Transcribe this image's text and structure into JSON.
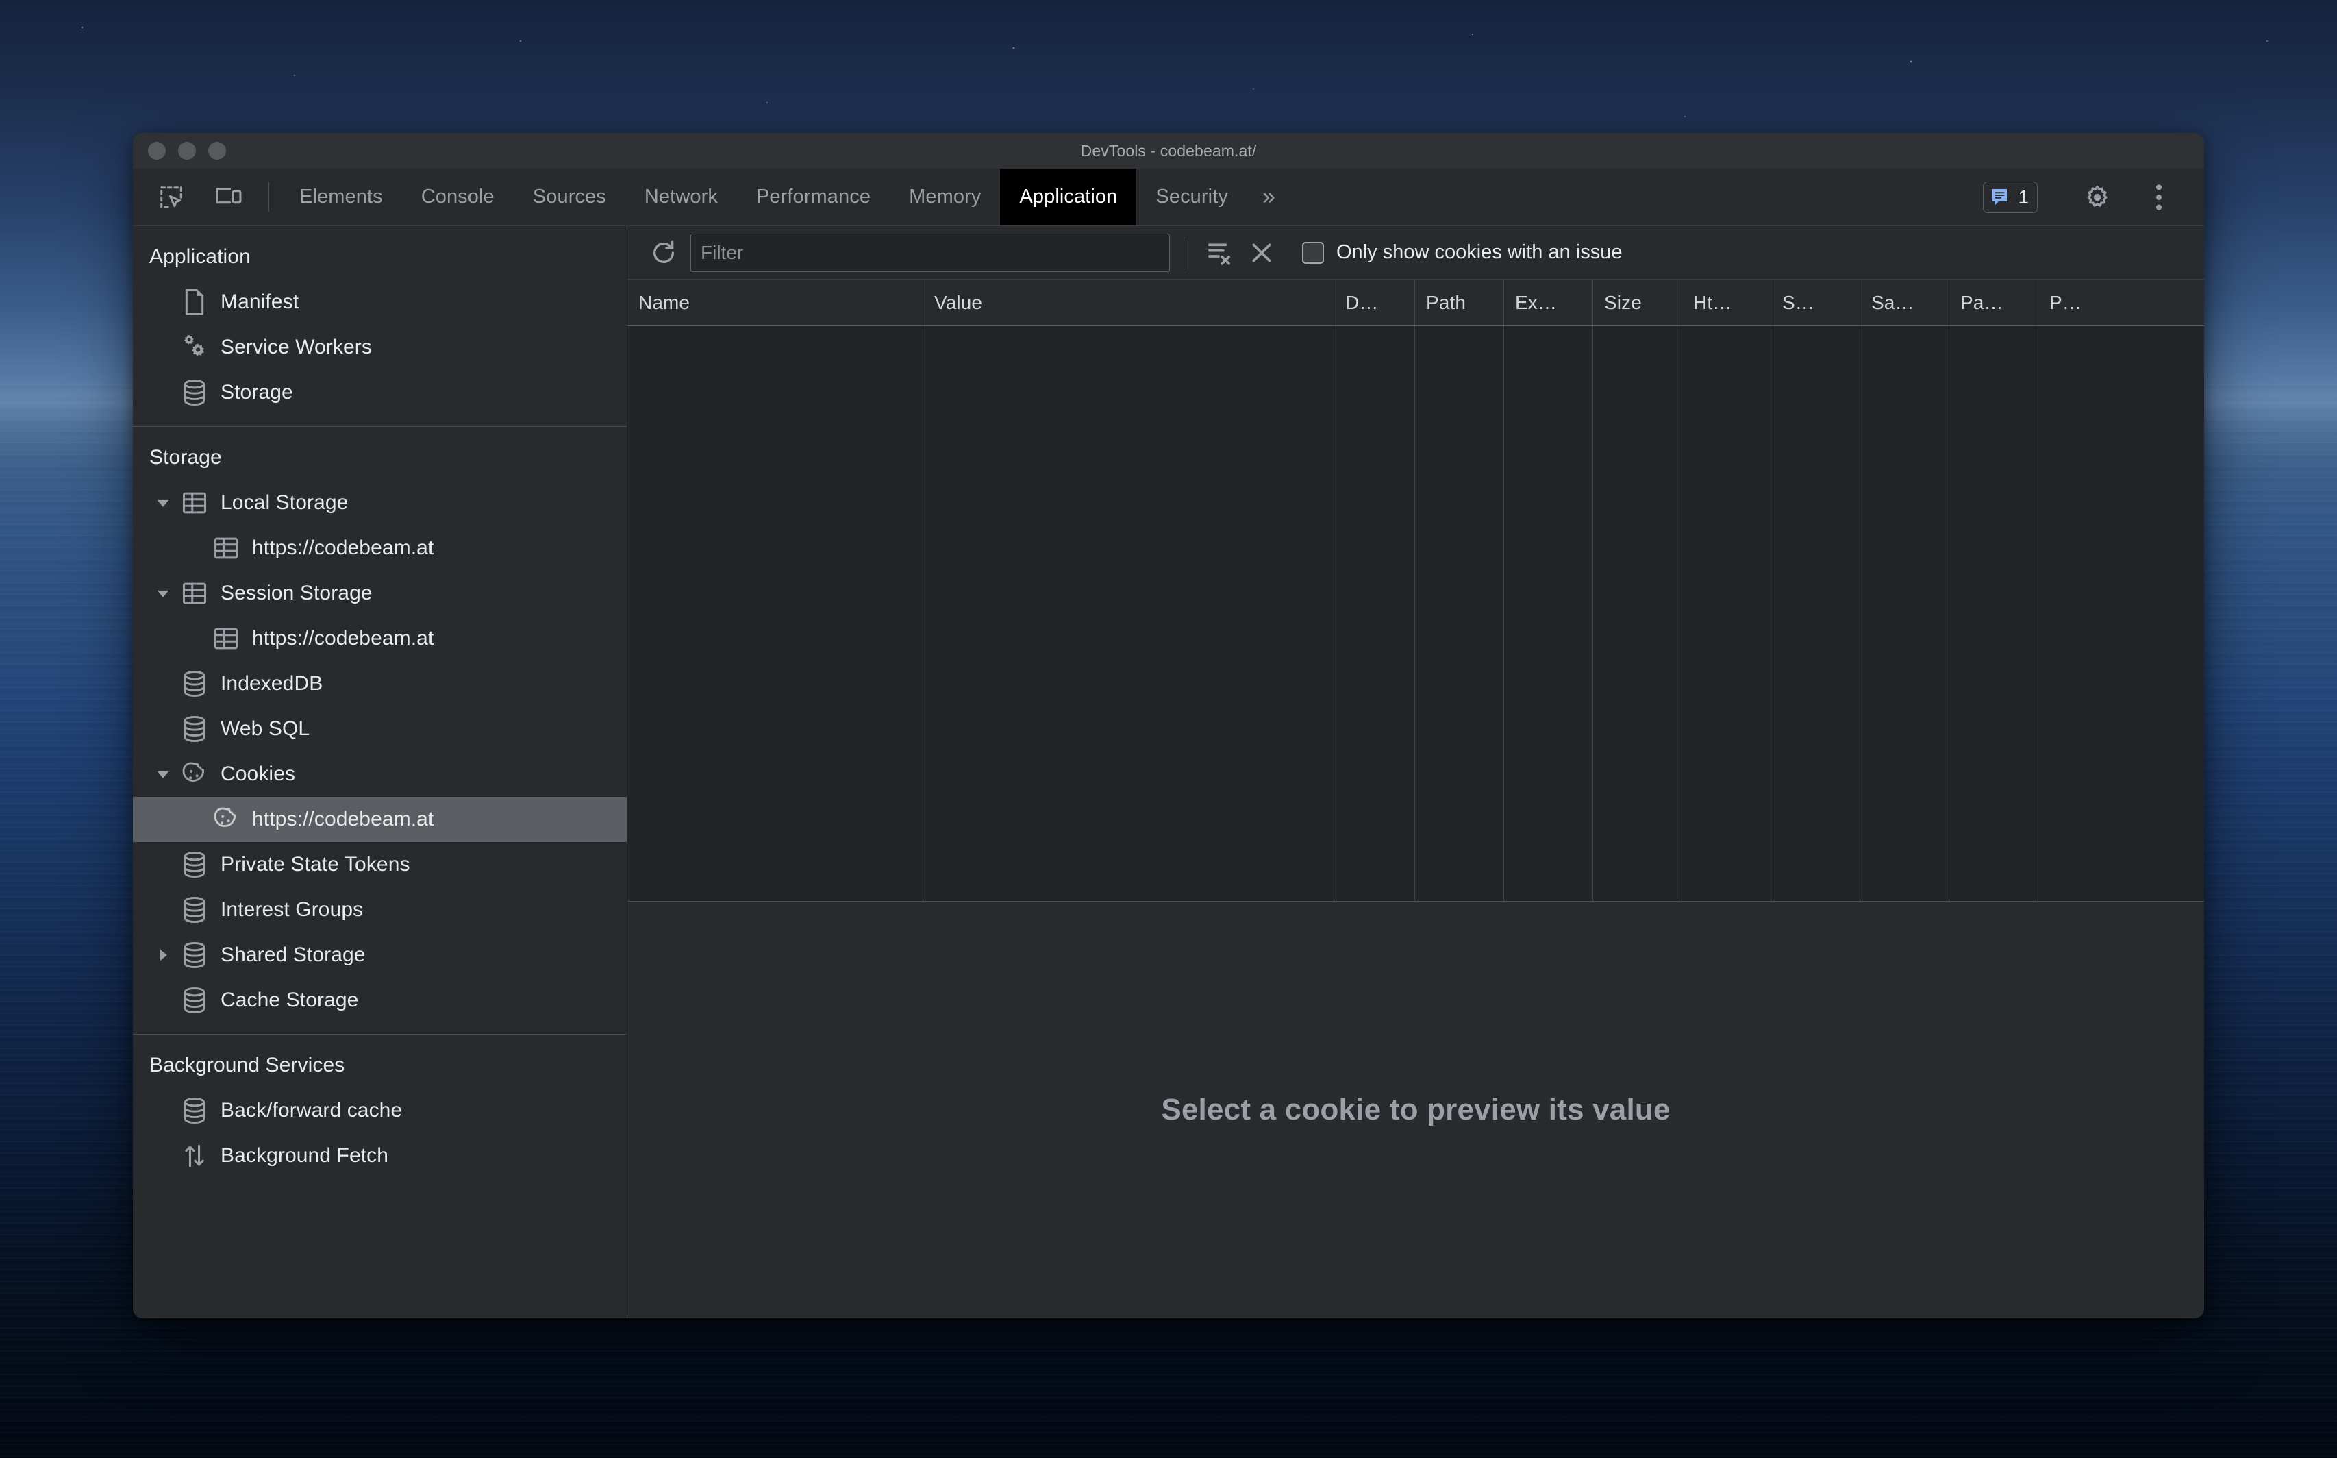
{
  "window": {
    "title": "DevTools - codebeam.at/",
    "traffic_lights": [
      "close",
      "minimize",
      "zoom"
    ]
  },
  "tabbar": {
    "inspect_icon": "inspect-element-icon",
    "device_icon": "device-toolbar-icon",
    "tabs": [
      {
        "label": "Elements",
        "active": false
      },
      {
        "label": "Console",
        "active": false
      },
      {
        "label": "Sources",
        "active": false
      },
      {
        "label": "Network",
        "active": false
      },
      {
        "label": "Performance",
        "active": false
      },
      {
        "label": "Memory",
        "active": false
      },
      {
        "label": "Application",
        "active": true
      },
      {
        "label": "Security",
        "active": false
      }
    ],
    "more_tabs_label": "»",
    "message_badge": {
      "icon": "message-icon",
      "count": "1"
    },
    "settings_icon": "gear-icon",
    "more_options_icon": "kebab-menu-icon"
  },
  "sidebar": {
    "sections": [
      {
        "title": "Application",
        "items": [
          {
            "label": "Manifest",
            "icon": "document-icon",
            "indent": 1,
            "twisty": "none",
            "selected": false
          },
          {
            "label": "Service Workers",
            "icon": "gears-icon",
            "indent": 1,
            "twisty": "none",
            "selected": false
          },
          {
            "label": "Storage",
            "icon": "database-icon",
            "indent": 1,
            "twisty": "none",
            "selected": false
          }
        ]
      },
      {
        "title": "Storage",
        "items": [
          {
            "label": "Local Storage",
            "icon": "table-icon",
            "indent": 1,
            "twisty": "expanded",
            "selected": false
          },
          {
            "label": "https://codebeam.at",
            "icon": "table-icon",
            "indent": 2,
            "twisty": "none",
            "selected": false
          },
          {
            "label": "Session Storage",
            "icon": "table-icon",
            "indent": 1,
            "twisty": "expanded",
            "selected": false
          },
          {
            "label": "https://codebeam.at",
            "icon": "table-icon",
            "indent": 2,
            "twisty": "none",
            "selected": false
          },
          {
            "label": "IndexedDB",
            "icon": "database-icon",
            "indent": 1,
            "twisty": "none",
            "selected": false
          },
          {
            "label": "Web SQL",
            "icon": "database-icon",
            "indent": 1,
            "twisty": "none",
            "selected": false
          },
          {
            "label": "Cookies",
            "icon": "cookie-icon",
            "indent": 1,
            "twisty": "expanded",
            "selected": false
          },
          {
            "label": "https://codebeam.at",
            "icon": "cookie-icon",
            "indent": 2,
            "twisty": "none",
            "selected": true
          },
          {
            "label": "Private State Tokens",
            "icon": "database-icon",
            "indent": 1,
            "twisty": "none",
            "selected": false
          },
          {
            "label": "Interest Groups",
            "icon": "database-icon",
            "indent": 1,
            "twisty": "none",
            "selected": false
          },
          {
            "label": "Shared Storage",
            "icon": "database-icon",
            "indent": 1,
            "twisty": "collapsed",
            "selected": false
          },
          {
            "label": "Cache Storage",
            "icon": "database-icon",
            "indent": 1,
            "twisty": "none",
            "selected": false
          }
        ]
      },
      {
        "title": "Background Services",
        "items": [
          {
            "label": "Back/forward cache",
            "icon": "database-icon",
            "indent": 1,
            "twisty": "none",
            "selected": false
          },
          {
            "label": "Background Fetch",
            "icon": "sync-arrows-icon",
            "indent": 1,
            "twisty": "none",
            "selected": false
          }
        ]
      }
    ]
  },
  "main": {
    "toolbar": {
      "refresh_icon": "refresh-icon",
      "filter_placeholder": "Filter",
      "filter_value": "",
      "clear_filtered_icon": "clear-filtered-cookies-icon",
      "clear_all_icon": "clear-all-cookies-icon",
      "issue_checkbox_label": "Only show cookies with an issue",
      "issue_checkbox_checked": false
    },
    "table": {
      "columns": [
        {
          "label": "Name",
          "width": "name"
        },
        {
          "label": "Value",
          "width": "value"
        },
        {
          "label": "D…",
          "width": "sm"
        },
        {
          "label": "Path",
          "width": "md"
        },
        {
          "label": "Ex…",
          "width": "md"
        },
        {
          "label": "Size",
          "width": "md"
        },
        {
          "label": "Ht…",
          "width": "md"
        },
        {
          "label": "S…",
          "width": "md"
        },
        {
          "label": "Sa…",
          "width": "md"
        },
        {
          "label": "Pa…",
          "width": "md"
        },
        {
          "label": "P…",
          "width": "md"
        }
      ],
      "rows": []
    },
    "preview_empty_message": "Select a cookie to preview its value"
  },
  "colors": {
    "panel_bg": "#282a2d",
    "table_bg": "#222427",
    "active_tab_bg": "#000000",
    "active_tab_text": "#ffffff",
    "inactive_tab_text": "#9aa0a6",
    "primary_text": "#e8eaed",
    "muted_text": "#9aa0a6",
    "selection_bg": "#5a5d61",
    "icon_gray": "#9aa0a6",
    "badge_blue": "#8ab4f8"
  }
}
